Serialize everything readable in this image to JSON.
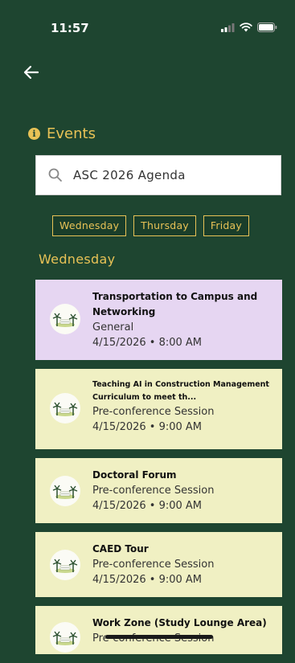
{
  "status_bar": {
    "time": "11:57"
  },
  "header": {
    "title": "Events"
  },
  "search": {
    "value": "ASC 2026 Agenda",
    "icon": "search-icon"
  },
  "day_tabs": [
    "Wednesday",
    "Thursday",
    "Friday"
  ],
  "section": {
    "heading": "Wednesday"
  },
  "events": [
    {
      "title": "Transportation to Campus and Networking",
      "category": "General",
      "datetime": "4/15/2026 • 8:00 AM",
      "color": "#e6d6f2"
    },
    {
      "title": "Teaching AI in Construction Management Curriculum to meet th...",
      "category": "Pre-conference Session",
      "datetime": "4/15/2026 • 9:00 AM",
      "color": "#f0f0c3"
    },
    {
      "title": "Doctoral Forum",
      "category": "Pre-conference Session",
      "datetime": "4/15/2026 • 9:00 AM",
      "color": "#f0f0c3"
    },
    {
      "title": "CAED Tour",
      "category": "Pre-conference Session",
      "datetime": "4/15/2026 • 9:00 AM",
      "color": "#f0f0c3"
    },
    {
      "title": "Work Zone (Study Lounge Area)",
      "category": "Pre-conference Session",
      "datetime": "",
      "color": "#f0f0c3"
    }
  ],
  "colors": {
    "background": "#1e4530",
    "accent": "#e8c256"
  }
}
